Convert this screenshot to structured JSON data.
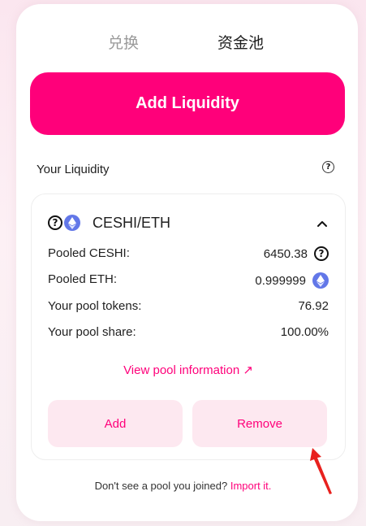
{
  "tabs": {
    "swap": "兑换",
    "pool": "资金池"
  },
  "add_liquidity_button": "Add Liquidity",
  "your_liquidity": {
    "title": "Your Liquidity",
    "help_icon": "question-circle-icon"
  },
  "position": {
    "pair_name": "CESHI/ETH",
    "token0_icon": "question-circle-icon",
    "token1_icon": "eth-icon",
    "collapse_icon": "chevron-up-icon",
    "rows": [
      {
        "label": "Pooled CESHI:",
        "value": "6450.38",
        "icon": "question-circle-icon"
      },
      {
        "label": "Pooled ETH:",
        "value": "0.999999",
        "icon": "eth-icon"
      },
      {
        "label": "Your pool tokens:",
        "value": "76.92"
      },
      {
        "label": "Your pool share:",
        "value": "100.00%"
      }
    ],
    "view_link": "View pool information ↗",
    "add_button": "Add",
    "remove_button": "Remove"
  },
  "footer": {
    "text": "Don't see a pool you joined? ",
    "link": "Import it."
  },
  "colors": {
    "accent": "#ff007a",
    "soft_button_bg": "#fde8f0",
    "eth_blue": "#6277e8",
    "annotation_arrow": "#e8211e"
  }
}
